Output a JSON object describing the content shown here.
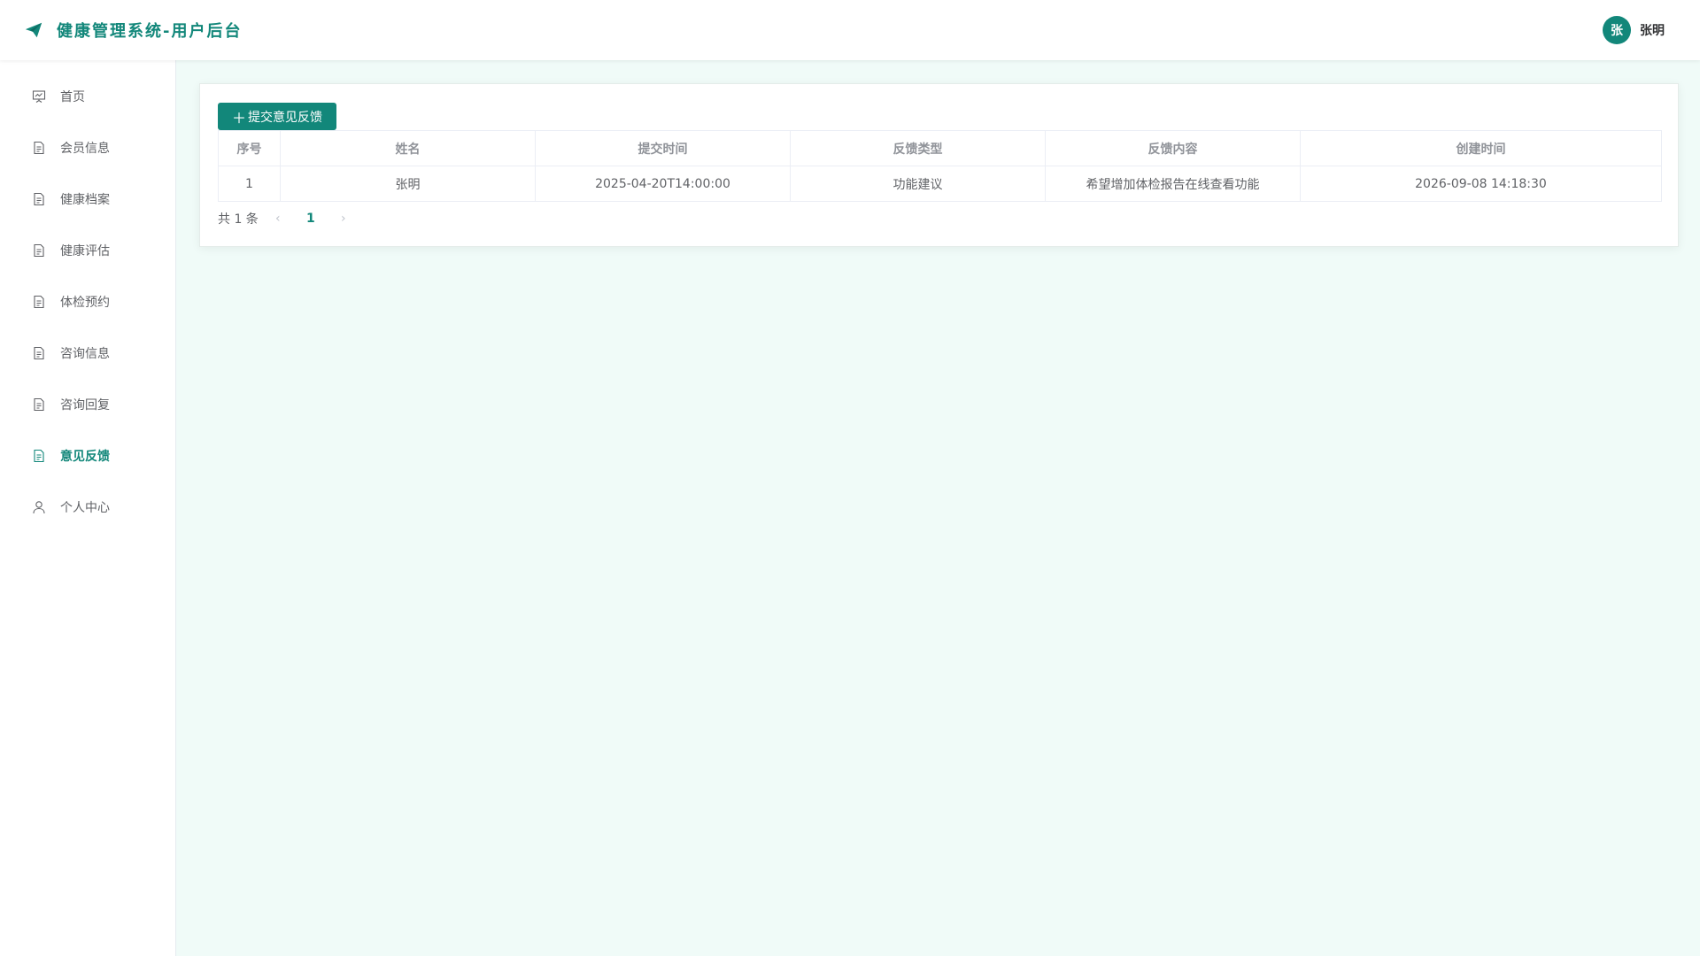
{
  "colors": {
    "accent": "#12877a",
    "background": "#f0fbf8"
  },
  "header": {
    "title": "健康管理系统-用户后台",
    "logo_icon": "paper-plane-icon",
    "user": {
      "avatar_text": "张",
      "name": "张明"
    }
  },
  "sidebar": {
    "items": [
      {
        "label": "首页",
        "icon": "presentation-board-icon"
      },
      {
        "label": "会员信息",
        "icon": "document-icon"
      },
      {
        "label": "健康档案",
        "icon": "document-icon"
      },
      {
        "label": "健康评估",
        "icon": "document-icon"
      },
      {
        "label": "体检预约",
        "icon": "document-icon"
      },
      {
        "label": "咨询信息",
        "icon": "document-icon"
      },
      {
        "label": "咨询回复",
        "icon": "document-icon"
      },
      {
        "label": "意见反馈",
        "icon": "document-icon",
        "active": true
      },
      {
        "label": "个人中心",
        "icon": "user-icon"
      }
    ]
  },
  "toolbar": {
    "add_label": "提交意见反馈",
    "add_prefix": "＋"
  },
  "table": {
    "columns": [
      "序号",
      "姓名",
      "提交时间",
      "反馈类型",
      "反馈内容",
      "创建时间"
    ],
    "rows": [
      [
        "1",
        "张明",
        "2025-04-20T14:00:00",
        "功能建议",
        "希望增加体检报告在线查看功能",
        "2026-09-08 14:18:30"
      ]
    ]
  },
  "pagination": {
    "total_text": "共 1 条",
    "current_page": "1",
    "prev_icon": "chevron-left-icon",
    "next_icon": "chevron-right-icon"
  }
}
